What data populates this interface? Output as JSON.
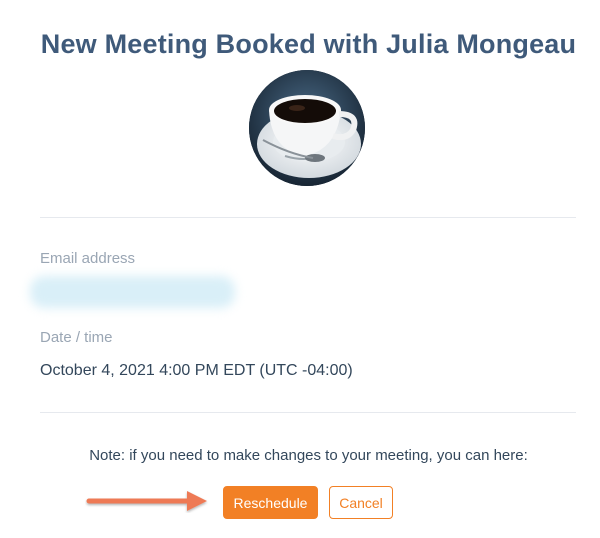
{
  "header": {
    "title": "New Meeting Booked with Julia Mongeau"
  },
  "avatar": {
    "icon": "coffee-cup-avatar"
  },
  "details": {
    "email_label": "Email address",
    "email_value": "",
    "date_label": "Date / time",
    "date_value": "October 4, 2021 4:00 PM EDT (UTC -04:00)"
  },
  "footer": {
    "note": "Note: if you need to make changes to your meeting, you can here:",
    "reschedule_label": "Reschedule",
    "cancel_label": "Cancel",
    "arrow_icon": "arrow-right-icon"
  },
  "colors": {
    "title": "#3f5a7a",
    "accent": "#f28025",
    "arrow": "#ee7a55",
    "label": "#9aa6b4",
    "text": "#33475b"
  }
}
